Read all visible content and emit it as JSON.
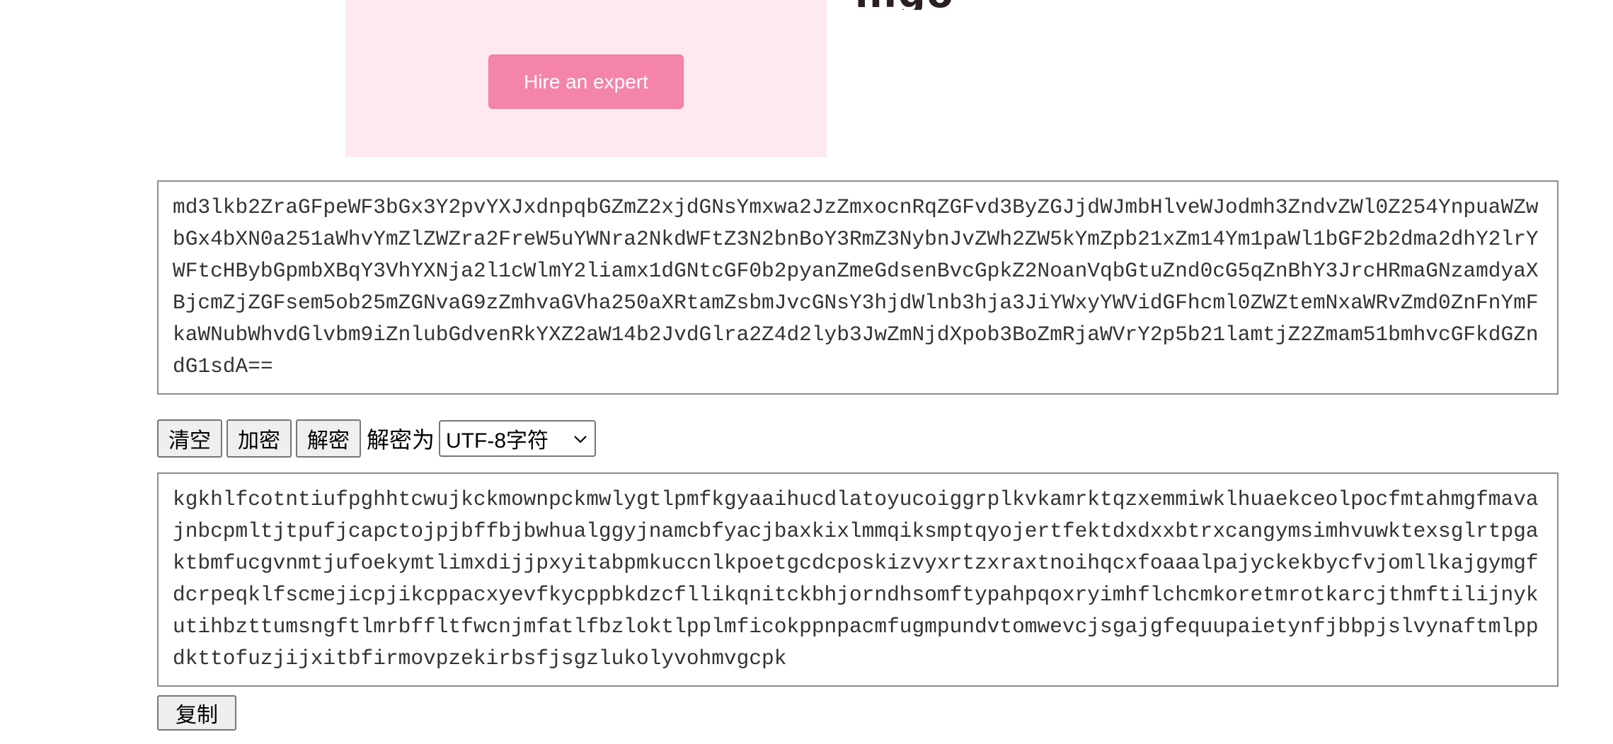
{
  "ad": {
    "partial_heading": "nigo",
    "cta_label": "Hire an expert"
  },
  "input_text": "md3lkb2ZraGFpeWF3bGx3Y2pvYXJxdnpqbGZmZ2xjdGNsYmxwa2JzZmxocnRqZGFvd3ByZGJjdWJmbHlveWJodmh3ZndvZWl0Z254YnpuaWZwbGx4bXN0a251aWhvYmZlZWZra2FreW5uYWNra2NkdWFtZ3N2bnBoY3RmZ3NybnJvZWh2ZW5kYmZpb21xZm14Ym1paWl1bGF2b2dma2dhY2lrYWFtcHBybGpmbXBqY3VhYXNja2l1cWlmY2liamx1dGNtcGF0b2pyanZmeGdsenBvcGpkZ2NoanVqbGtuZnd0cG5qZnBhY3JrcHRmaGNzamdyaXBjcmZjZGFsem5ob25mZGNvaG9zZmhvaGVha250aXRtamZsbmJvcGNsY3hjdWlnb3hja3JiYWxyYWVidGFhcml0ZWZtemNxaWRvZmd0ZnFnYmFkaWNubWhvdGlvbm9iZnlubGdvenRkYXZ2aW14b2JvdGlra2Z4d2lyb3JwZmNjdXpob3BoZmRjaWVrY2p5b21lamtjZ2Zmam51bmhvcGFkdGZndG1sdA==",
  "controls": {
    "clear_label": "清空",
    "encrypt_label": "加密",
    "decrypt_label": "解密",
    "decrypt_as_label": "解密为",
    "charset_selected": "UTF-8字符"
  },
  "output_text": "kgkhlfcotntiufpghhtcwujkckmownpckmwlygtlpmfkgyaaihucdlatoyucoiggrplkvkamrktqzxemmiwklhuaekceolpocfmtahmgfmavajnbcpmltjtpufjcapctojpjbffbjbwhualggyjnamcbfyacjbaxkixlmmqiksmptqyojertfektdxdxxbtrxcangymsimhvuwktexsglrtpgaktbmfucgvnmtjufoekymtlimxdijjpxyitabpmkuccnlkpoetgcdcposkizvyxrtzxraxtnoihqcxfoaaalpajyckekbycfvjomllkajgymgfdcrpeqklfscmejicpjikcppacxyevfkycppbkdzcfllikqnitckbhjorndhsomftypahpqoxryimhflchcmkoretmrotkarcjthmftilijnykutihbzttumsngftlmrbffltfwcnjmfatlfbzloktlpplmficokppnpacmfugmpundvtomwevcjsgajgfequupaietynfjbbpjslvynaftmlppdkttofuzjijxitbfirmovpzekirbsfjsgzlukolyvohmvgcpk",
  "copy_label": "复制",
  "icons": {
    "select_chevron": "chevron-down-icon"
  },
  "colors": {
    "ad_background": "#fde9ee",
    "ad_button": "#f484aa"
  }
}
